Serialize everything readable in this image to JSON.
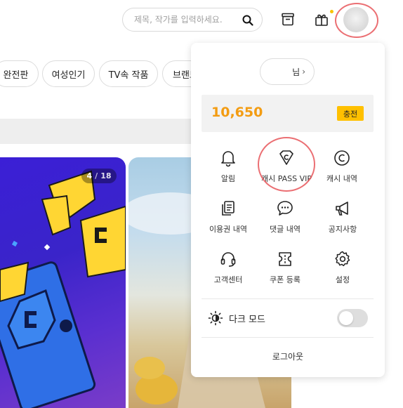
{
  "header": {
    "search_placeholder": "제목, 작가를 입력하세요.",
    "search_icon": "search-icon",
    "library_icon": "library-box-icon",
    "gift_icon": "gift-icon",
    "gift_badge_color": "#f7c200"
  },
  "categories": [
    "완전판",
    "여성인기",
    "TV속 작품",
    "브랜드"
  ],
  "banner": {
    "page_current": "4",
    "page_total": "18"
  },
  "profile_menu": {
    "nickname_suffix": "님",
    "cash_amount": "10,650",
    "charge_label": "충전",
    "accent_color": "#f39c12",
    "charge_color": "#ffc000",
    "items": [
      {
        "label": "알림",
        "icon": "bell-icon"
      },
      {
        "label": "캐시 PASS VIP",
        "icon": "pass-vip-icon"
      },
      {
        "label": "캐시 내역",
        "icon": "cash-history-icon"
      },
      {
        "label": "이용권 내역",
        "icon": "ticket-history-icon"
      },
      {
        "label": "댓글 내역",
        "icon": "comment-icon"
      },
      {
        "label": "공지사항",
        "icon": "megaphone-icon"
      },
      {
        "label": "고객센터",
        "icon": "headset-icon"
      },
      {
        "label": "쿠폰 등록",
        "icon": "coupon-icon"
      },
      {
        "label": "설정",
        "icon": "gear-icon"
      }
    ],
    "dark_mode_label": "다크 모드",
    "dark_mode_on": false,
    "logout_label": "로그아웃"
  }
}
